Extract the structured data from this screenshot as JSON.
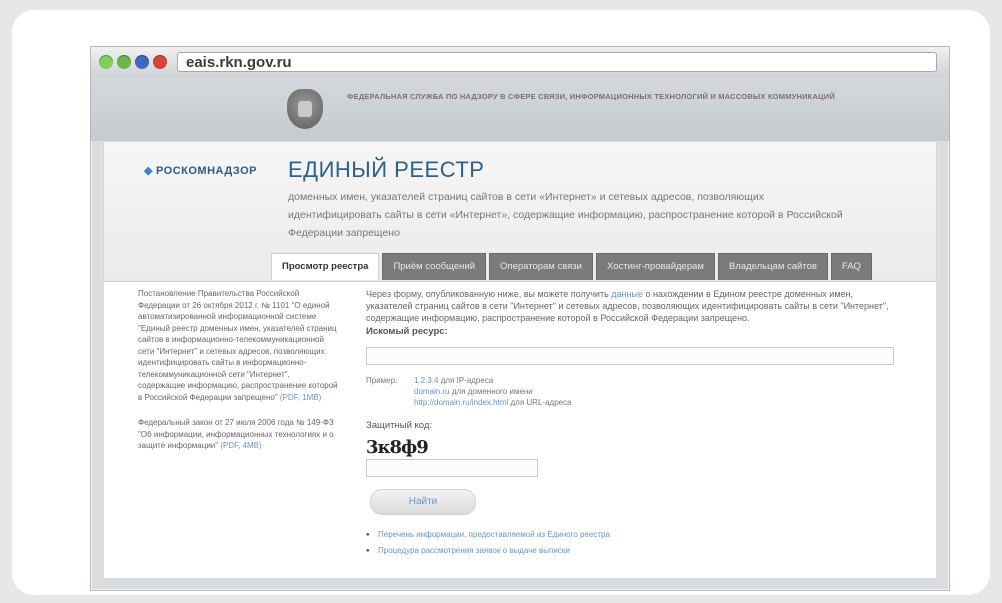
{
  "browser": {
    "url": "eais.rkn.gov.ru"
  },
  "header": {
    "agency": "ФЕДЕРАЛЬНАЯ СЛУЖБА ПО НАДЗОРУ В СФЕРЕ СВЯЗИ, ИНФОРМАЦИОННЫХ ТЕХНОЛОГИЙ И МАССОВЫХ КОММУНИКАЦИЙ"
  },
  "title_panel": {
    "logo": "РОСКОМНАДЗОР",
    "title": "ЕДИНЫЙ РЕЕСТР",
    "description": "доменных имен, указателей страниц сайтов в сети «Интернет» и сетевых адресов, позволяющих идентифицировать сайты в сети «Интернет», содержащие информацию, распространение которой в Российской Федерации запрещено"
  },
  "tabs": [
    "Просмотр реестра",
    "Приём сообщений",
    "Операторам связи",
    "Хостинг-провайдерам",
    "Владельцам сайтов",
    "FAQ"
  ],
  "left_col": {
    "block1": "Постановление Правительства Российской Федерации от 26 октября 2012 г. № 1101 \"О единой автоматизированной информационной системе \"Единый реестр доменных имен, указателей страниц сайтов в информационно-телекоммуникационной сети \"Интернет\" и сетевых адресов, позволяющих идентифицировать сайты в информационно-телекоммуникационной сети \"Интернет\", содержащие информацию, распространение которой в Российской Федерации запрещено\"",
    "block1_link": "(PDF, 1MB)",
    "block2": "Федеральный закон от 27 июля 2006 года № 149-ФЗ \"Об информации, информационных технологиях и о защите информации\"",
    "block2_link": "(PDF, 4MB)"
  },
  "main": {
    "intro": "Через форму, опубликованную ниже, вы можете получить",
    "intro_link": "данные",
    "intro_rest": "о нахождении в Едином реестре доменных имен, указателей страниц сайтов в сети \"Интернет\" и сетевых адресов, позволяющих идентифицировать сайты в сети \"Интернет\", содержащие информацию, распространение которой в Российской Федерации запрещено.",
    "resource_label": "Искомый ресурс:",
    "resource_value": "",
    "examples_label": "Пример:",
    "example1_link": "1.2.3.4",
    "example1_text": "для IP-адреса",
    "example2_link": "domain.ru",
    "example2_text": "для доменного имени",
    "example3_link": "http://domain.ru/index.html",
    "example3_text": "для URL-адреса",
    "captcha_label": "Защитный код:",
    "captcha_text": "3к8ф9",
    "captcha_value": "",
    "find_label": "Найти",
    "bullet1": "Перечень информации, предоставляемой из Единого реестра",
    "bullet2": "Процедура рассмотрения заявок о выдаче выписки"
  }
}
